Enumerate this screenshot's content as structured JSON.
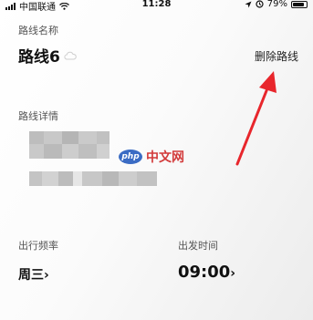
{
  "status_bar": {
    "carrier": "中国联通",
    "time": "11:28",
    "battery": "79%",
    "battery_level": 0.79
  },
  "route": {
    "name_label": "路线名称",
    "name": "路线6",
    "delete_label": "删除路线",
    "details_label": "路线详情"
  },
  "watermark": {
    "logo": "php",
    "text": "中文网"
  },
  "schedule": {
    "frequency_label": "出行频率",
    "frequency_value": "周三",
    "depart_label": "出发时间",
    "depart_value": "09:00",
    "chevron": "›"
  },
  "icons": {
    "cloud": "cloud-icon",
    "wifi": "wifi-icon",
    "location": "location-arrow-icon",
    "alarm": "alarm-icon",
    "battery": "battery-icon",
    "arrow": "annotation-arrow-icon"
  },
  "colors": {
    "annotation_arrow": "#e8262c",
    "watermark_red": "#d23a3a",
    "watermark_blue": "#3b6cc4"
  }
}
